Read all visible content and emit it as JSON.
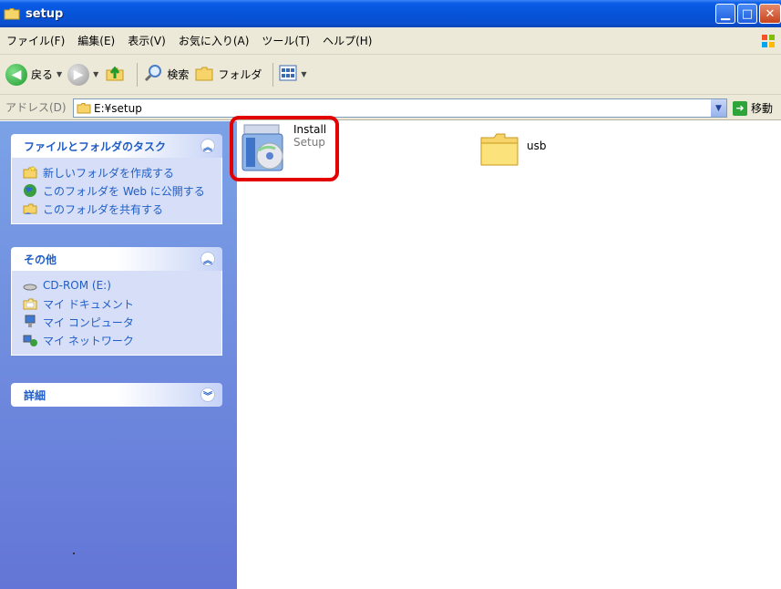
{
  "window": {
    "title": "setup"
  },
  "menu": {
    "items": [
      "ファイル(F)",
      "編集(E)",
      "表示(V)",
      "お気に入り(A)",
      "ツール(T)",
      "ヘルプ(H)"
    ]
  },
  "toolbar": {
    "back_label": "戻る",
    "search_label": "検索",
    "folders_label": "フォルダ"
  },
  "address": {
    "label": "アドレス(D)",
    "path": "E:¥setup",
    "go_label": "移動"
  },
  "tasks_panel": {
    "title": "ファイルとフォルダのタスク",
    "items": [
      "新しいフォルダを作成する",
      "このフォルダを Web に公開する",
      "このフォルダを共有する"
    ]
  },
  "other_panel": {
    "title": "その他",
    "items": [
      "CD-ROM (E:)",
      "マイ ドキュメント",
      "マイ コンピュータ",
      "マイ ネットワーク"
    ]
  },
  "details_panel": {
    "title": "詳細"
  },
  "files": [
    {
      "name": "Install",
      "type": "Setup"
    },
    {
      "name": "usb"
    }
  ],
  "colors": {
    "highlight": "#e30000",
    "link": "#215dc6"
  }
}
